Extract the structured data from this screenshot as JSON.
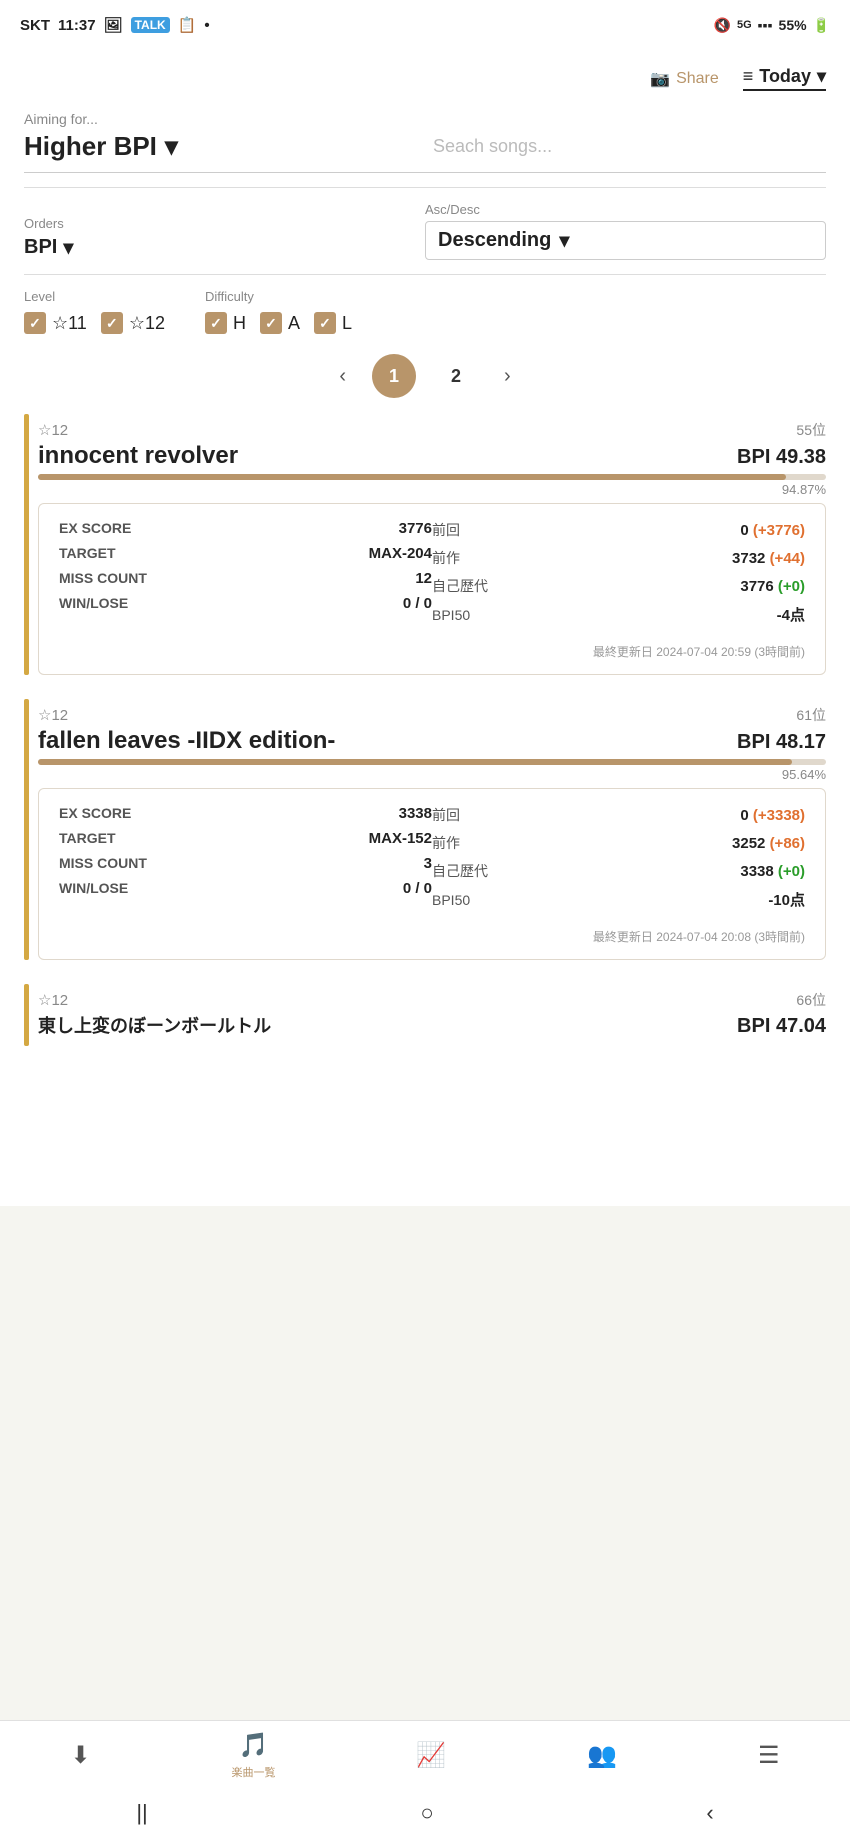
{
  "statusBar": {
    "carrier": "SKT",
    "time": "11:37",
    "battery": "55%"
  },
  "header": {
    "shareLabel": "Share",
    "todayLabel": "Today"
  },
  "aiming": {
    "label": "Aiming for...",
    "value": "Higher BPI",
    "searchPlaceholder": "Seach songs..."
  },
  "orders": {
    "label": "Orders",
    "value": "BPI",
    "ascDescLabel": "Asc/Desc",
    "ascDescValue": "Descending"
  },
  "level": {
    "label": "Level",
    "items": [
      "☆11",
      "☆12"
    ]
  },
  "difficulty": {
    "label": "Difficulty",
    "items": [
      "H",
      "A",
      "L"
    ]
  },
  "pagination": {
    "prev": "‹",
    "next": "›",
    "current": 1,
    "pages": [
      1,
      2
    ]
  },
  "songs": [
    {
      "level": "☆12",
      "rank": "55位",
      "title": "innocent revolver",
      "bpi": "BPI 49.38",
      "progress": 94.87,
      "progressLabel": "94.87%",
      "detail": {
        "exScore": {
          "key": "EX SCORE",
          "val": "3776"
        },
        "target": {
          "key": "TARGET",
          "val": "MAX-204"
        },
        "missCount": {
          "key": "MISS COUNT",
          "val": "12"
        },
        "winLose": {
          "key": "WIN/LOSE",
          "val": "0 / 0"
        },
        "prevLabel": "前回",
        "prevVal": "0",
        "prevDiff": "(+3776)",
        "prevWorkLabel": "前作",
        "prevWorkVal": "3732",
        "prevWorkDiff": "(+44)",
        "selfLabel": "自己歴代",
        "selfVal": "3776",
        "selfDiff": "(+0)",
        "bpi50Label": "BPI50",
        "bpi50Val": "-4点",
        "timestamp": "最終更新日 2024-07-04 20:59 (3時間前)"
      }
    },
    {
      "level": "☆12",
      "rank": "61位",
      "title": "fallen leaves -IIDX edition-",
      "bpi": "BPI 48.17",
      "progress": 95.64,
      "progressLabel": "95.64%",
      "detail": {
        "exScore": {
          "key": "EX SCORE",
          "val": "3338"
        },
        "target": {
          "key": "TARGET",
          "val": "MAX-152"
        },
        "missCount": {
          "key": "MISS COUNT",
          "val": "3"
        },
        "winLose": {
          "key": "WIN/LOSE",
          "val": "0 / 0"
        },
        "prevLabel": "前回",
        "prevVal": "0",
        "prevDiff": "(+3338)",
        "prevWorkLabel": "前作",
        "prevWorkVal": "3252",
        "prevWorkDiff": "(+86)",
        "selfLabel": "自己歴代",
        "selfVal": "3338",
        "selfDiff": "(+0)",
        "bpi50Label": "BPI50",
        "bpi50Val": "-10点",
        "timestamp": "最終更新日 2024-07-04 20:08 (3時間前)"
      }
    },
    {
      "level": "☆12",
      "rank": "66位",
      "title": "東し上変のぼーンボールトル",
      "bpi": "BPI 47.04",
      "progress": 0,
      "progressLabel": "",
      "detail": null
    }
  ],
  "bottomNav": {
    "items": [
      {
        "icon": "⬇",
        "label": "",
        "active": false
      },
      {
        "icon": "🎵",
        "label": "楽曲一覧",
        "active": true
      },
      {
        "icon": "📈",
        "label": "",
        "active": false
      },
      {
        "icon": "👥",
        "label": "",
        "active": false
      },
      {
        "icon": "☰",
        "label": "",
        "active": false
      }
    ]
  },
  "systemNav": {
    "back": "‹",
    "home": "○",
    "recent": "||"
  }
}
